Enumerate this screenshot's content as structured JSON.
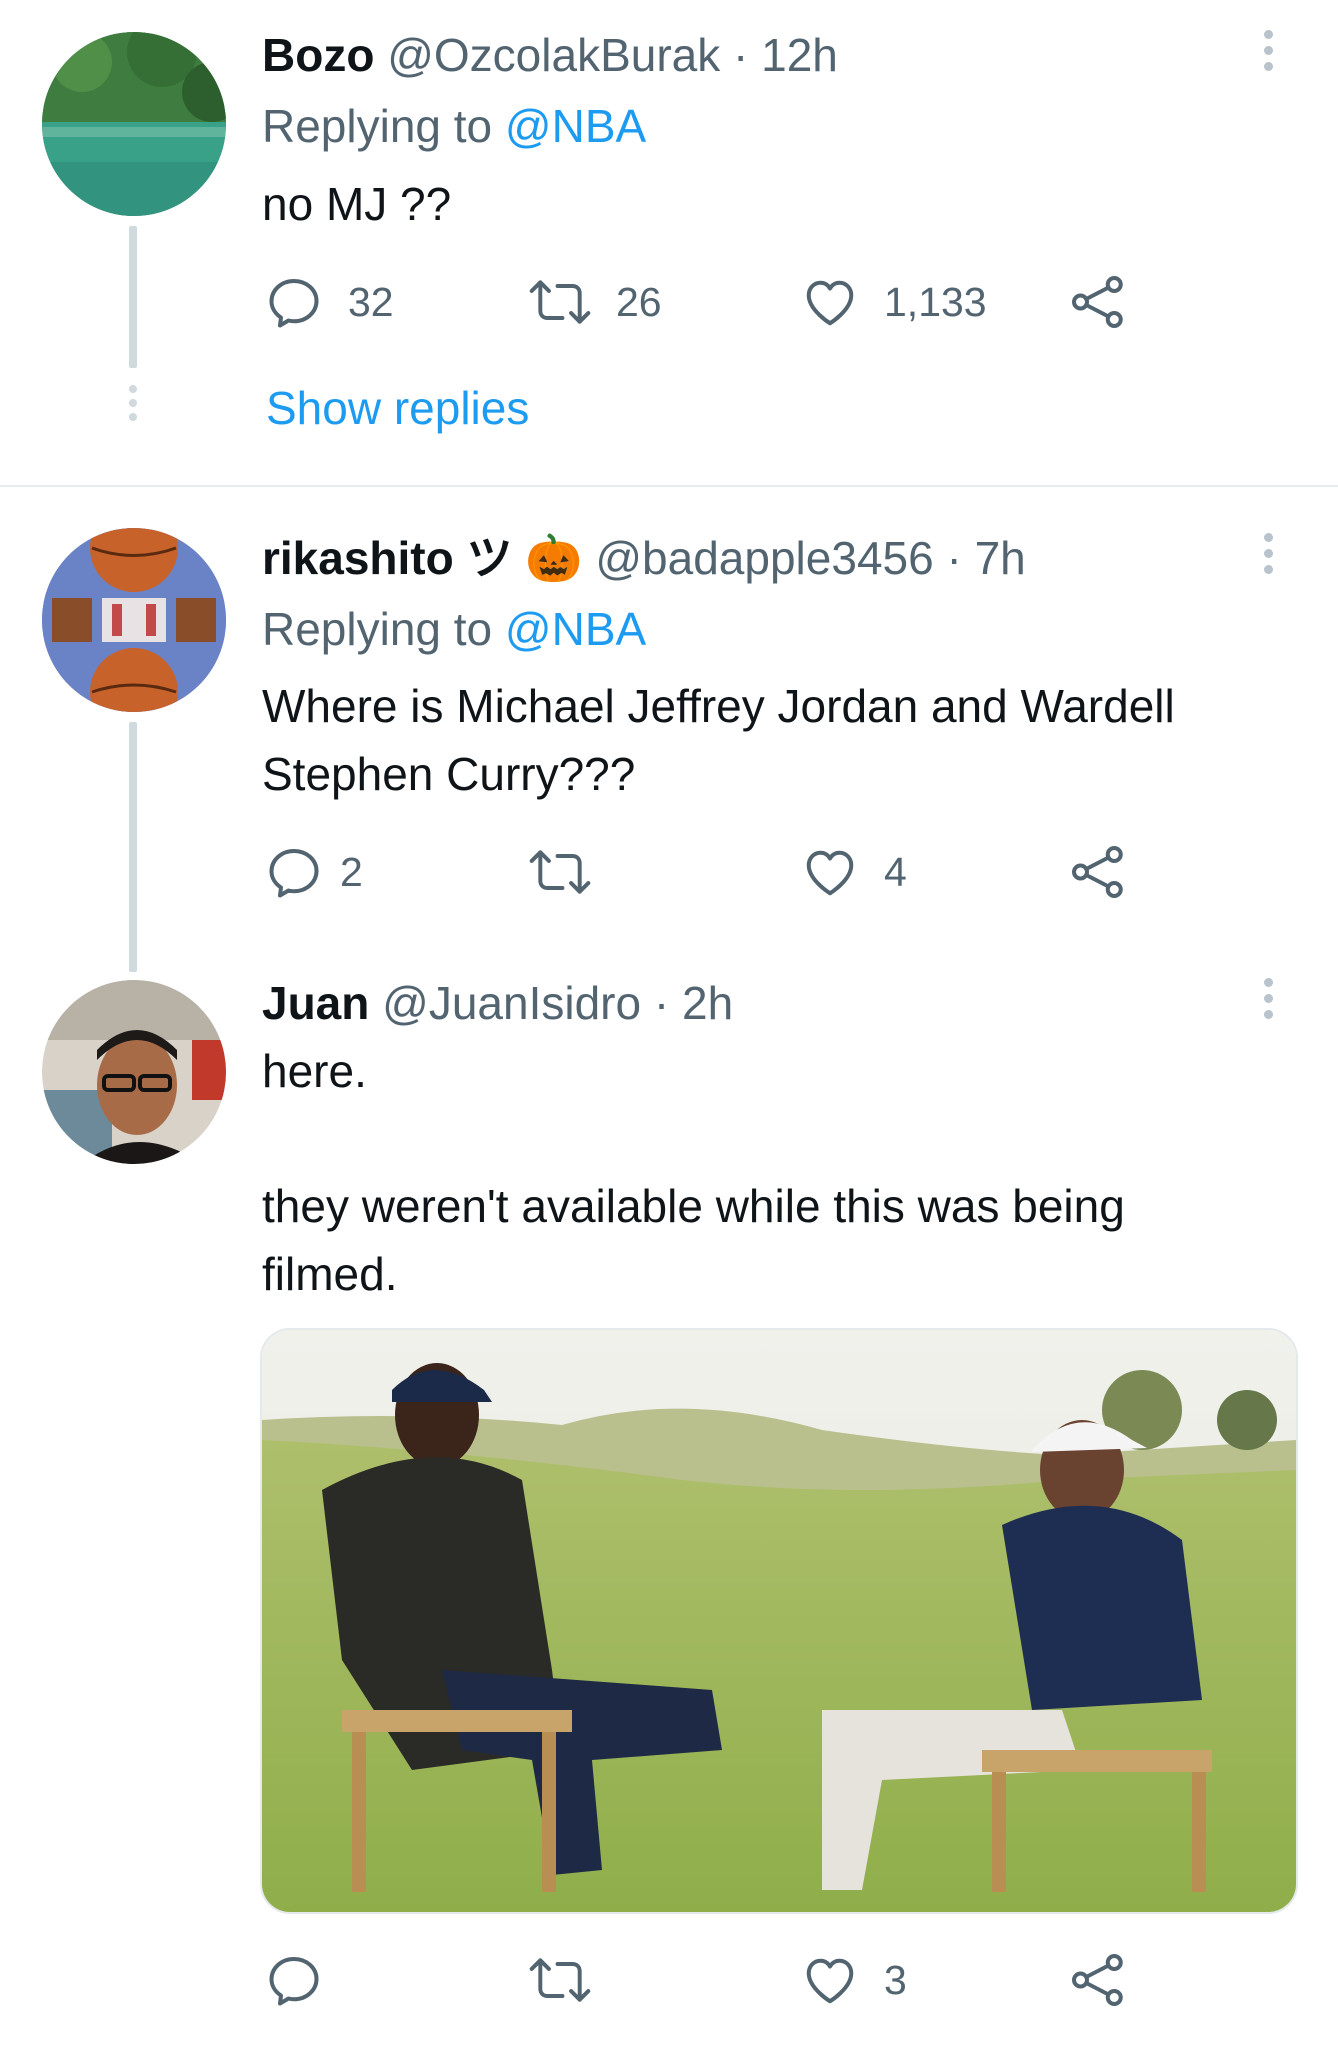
{
  "tweets": [
    {
      "name": "Bozo",
      "handle": "@OzcolakBurak",
      "separator": "·",
      "time": "12h",
      "replying_prefix": "Replying to",
      "replying_to": "@NBA",
      "text": "no MJ ??",
      "replies": "32",
      "retweets": "26",
      "likes": "1,133",
      "show_replies": "Show replies"
    },
    {
      "name": "rikashito ツ",
      "emoji": "🎃",
      "handle": "@badapple3456",
      "separator": "·",
      "time": "7h",
      "replying_prefix": "Replying to",
      "replying_to": "@NBA",
      "text_line1": "Where is Michael Jeffrey Jordan and Wardell",
      "text_line2": "Stephen Curry???",
      "replies": "2",
      "retweets": "",
      "likes": "4"
    },
    {
      "name": "Juan",
      "handle": "@JuanIsidro",
      "separator": "·",
      "time": "2h",
      "text_line1": "here.",
      "text_line2": "they weren't available while this was being",
      "text_line3": "filmed.",
      "replies": "",
      "retweets": "",
      "likes": "3"
    }
  ],
  "icons": {
    "reply": "reply-icon",
    "retweet": "retweet-icon",
    "like": "heart-icon",
    "share": "share-icon",
    "more": "more-vertical-icon"
  },
  "colors": {
    "link": "#1d9bf0",
    "secondary_text": "#536471",
    "primary_text": "#0f1419",
    "thread_line": "#cfd9de"
  }
}
